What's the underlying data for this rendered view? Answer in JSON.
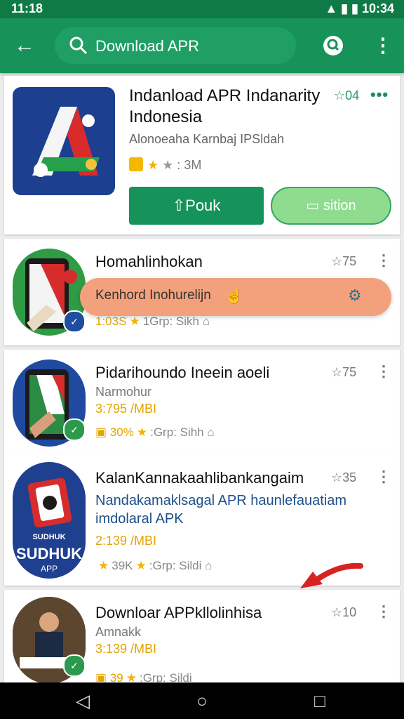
{
  "status_bar": {
    "time_left": "11:18",
    "time_right": "10:34"
  },
  "search": {
    "query": "Download APR"
  },
  "featured": {
    "title": "Indanload APR Indanarity Indonesia",
    "rating": "04",
    "developer": "Alonoeaha Karnbaj IPSldah",
    "meta": "3M",
    "install_label": "Pouk",
    "option_label": "sition"
  },
  "toast": {
    "text": "Kenhord Inohurelijn"
  },
  "apps": [
    {
      "title": "Homahlinhokan",
      "rating": "75",
      "meta_left": "1:03S",
      "meta_mid": "1Grp: Sikh",
      "price": "",
      "sub": ""
    },
    {
      "title": "Pidarihoundo Ineein aoeli",
      "sub": "Narmohur",
      "price": "3:795 /MBI",
      "meta_left": "30%",
      "meta_mid": "Grp: Sihh",
      "rating": "75"
    },
    {
      "title": "KalanKannakaahlibankangaim",
      "sub": "Nandakamaklsagal APR haunlefauatiam imdolaral APK",
      "price": "2:139 /MBI",
      "meta_left": "39K",
      "meta_mid": "Grp: Sildi",
      "rating": "35"
    },
    {
      "title": "Downloar APPkllolinhisa",
      "sub": "Amnakk",
      "price": "3:139 /MBI",
      "meta_left": "39",
      "meta_mid": "Grp: Sildi",
      "rating": "10"
    }
  ],
  "colors": {
    "app_bar": "#17935a",
    "primary_button": "#15935a",
    "toast": "#f3a17d"
  }
}
